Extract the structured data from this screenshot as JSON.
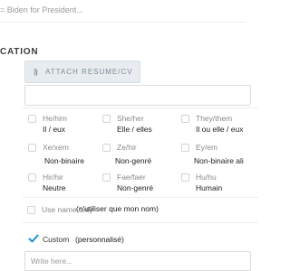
{
  "top_input": {
    "text": "= Biden for President..."
  },
  "section": {
    "title": "CATION"
  },
  "attach": {
    "label": "ATTACH RESUME/CV"
  },
  "pronouns": {
    "options": [
      {
        "label": "He/him",
        "sub": "Il / eux"
      },
      {
        "label": "She/her",
        "sub": "Elle / elles"
      },
      {
        "label": "They/them",
        "sub": "Il ou elle / eux"
      },
      {
        "label": "Xe/xem",
        "sub": "Non-binaire"
      },
      {
        "label": "Ze/hir",
        "sub": "Non-genré"
      },
      {
        "label": "Ey/em",
        "sub": "Non-binaire ali"
      },
      {
        "label": "Hir/hir",
        "sub": "Neutre"
      },
      {
        "label": "Fae/faer",
        "sub": "Non-genré"
      },
      {
        "label": "Hu/hu",
        "sub": "Humain"
      }
    ],
    "use_name_only": {
      "label": "Use name only",
      "note": "(n'utiliser que mon nom)"
    },
    "custom": {
      "label": "Custom",
      "note": "(personnalisé)",
      "checked": true,
      "placeholder": "Write here..."
    }
  },
  "colors": {
    "accent": "#1a8fd6",
    "button_bg": "#e8ecf1",
    "border": "#dcdcdc"
  }
}
